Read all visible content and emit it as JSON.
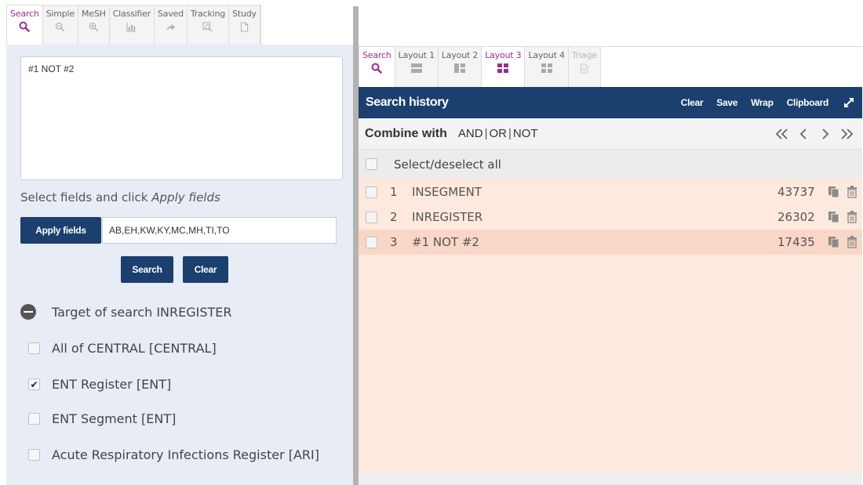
{
  "left_tabs": [
    {
      "label": "Search",
      "icon": "search-icon",
      "active": true
    },
    {
      "label": "Simple",
      "icon": "zoom-out-icon"
    },
    {
      "label": "MeSH",
      "icon": "zoom-in-icon"
    },
    {
      "label": "Classifier",
      "icon": "bar-chart-icon"
    },
    {
      "label": "Saved",
      "icon": "share-arrow-icon"
    },
    {
      "label": "Tracking",
      "icon": "tracking-icon"
    },
    {
      "label": "Study",
      "icon": "document-icon"
    }
  ],
  "query": {
    "text": "#1 NOT #2"
  },
  "fields": {
    "hint_prefix": "Select fields and click ",
    "hint_emph": "Apply fields",
    "apply_label": "Apply fields",
    "value": "AB,EH,KW,KY,MC,MH,TI,TO"
  },
  "actions": {
    "search_label": "Search",
    "clear_label": "Clear"
  },
  "target": {
    "label": "Target of search INREGISTER"
  },
  "databases": [
    {
      "label": "All of CENTRAL [CENTRAL]",
      "checked": false
    },
    {
      "label": "ENT Register [ENT]",
      "checked": true
    },
    {
      "label": "ENT Segment [ENT]",
      "checked": false
    },
    {
      "label": "Acute Respiratory Infections Register [ARI]",
      "checked": false
    }
  ],
  "right_tabs": [
    {
      "label": "Search",
      "icon": "search-icon",
      "active": true
    },
    {
      "label": "Layout 1",
      "icon": "layout-1-icon"
    },
    {
      "label": "Layout 2",
      "icon": "layout-2-icon"
    },
    {
      "label": "Layout 3",
      "icon": "layout-3-icon",
      "active_purple": true
    },
    {
      "label": "Layout 4",
      "icon": "layout-4-icon"
    },
    {
      "label": "Triage",
      "icon": "triage-icon",
      "disabled": true
    }
  ],
  "history": {
    "title": "Search history",
    "actions": {
      "clear": "Clear",
      "save": "Save",
      "wrap": "Wrap",
      "clipboard": "Clipboard"
    },
    "combine_label": "Combine with",
    "ops": {
      "and": "AND",
      "or": "OR",
      "not": "NOT"
    },
    "select_all": "Select/deselect all",
    "rows": [
      {
        "num": "1",
        "query": "INSEGMENT",
        "count": "43737"
      },
      {
        "num": "2",
        "query": "INREGISTER",
        "count": "26302"
      },
      {
        "num": "3",
        "query": "#1 NOT #2",
        "count": "17435",
        "highlight": true
      }
    ]
  },
  "colors": {
    "accent": "#9b2d8e",
    "navy": "#1b3f6e",
    "panel": "#e8ecf4",
    "history_bg": "#fde9de",
    "highlight": "#f9d7c6"
  }
}
